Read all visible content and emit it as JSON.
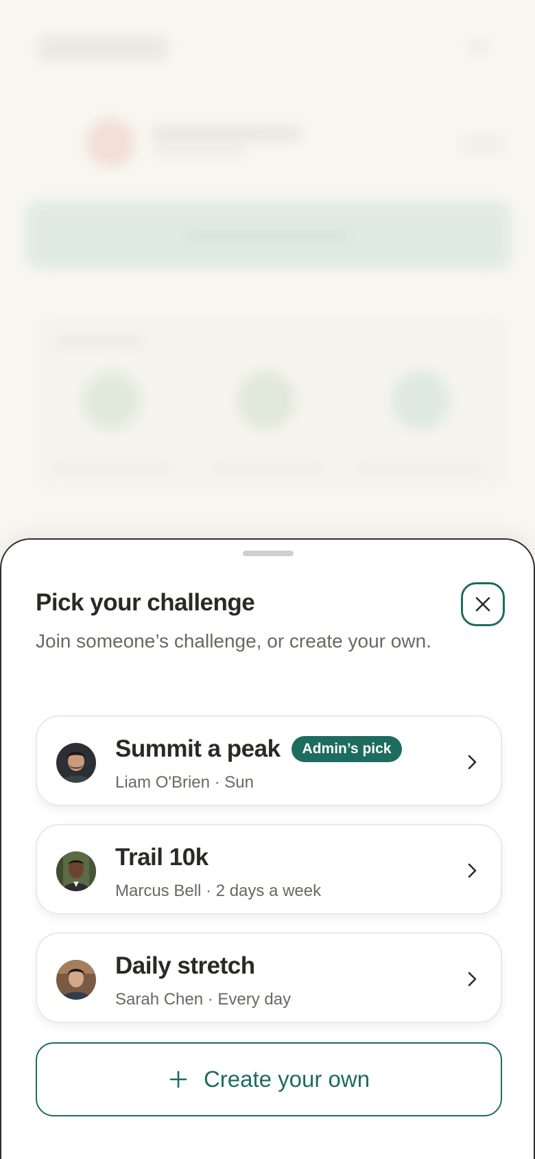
{
  "sheet": {
    "title": "Pick your challenge",
    "subtitle": "Join someone’s challenge, or create your own.",
    "close_icon": "close-icon"
  },
  "challenges": [
    {
      "title": "Summit a peak",
      "badge": "Admin’s pick",
      "meta": "Liam O'Brien · Sun",
      "avatar_icon": "avatar-liam"
    },
    {
      "title": "Trail 10k",
      "badge": "",
      "meta": "Marcus Bell · 2 days a week",
      "avatar_icon": "avatar-marcus"
    },
    {
      "title": "Daily stretch",
      "badge": "",
      "meta": "Sarah Chen · Every day",
      "avatar_icon": "avatar-sarah"
    }
  ],
  "create": {
    "label": "Create your own",
    "icon": "plus-icon"
  },
  "colors": {
    "accent": "#1e6b60",
    "background": "#f7f5f0"
  }
}
